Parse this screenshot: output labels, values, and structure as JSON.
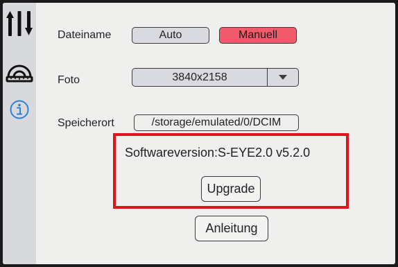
{
  "sidebar": {
    "items": [
      {
        "icon": "sliders-icon"
      },
      {
        "icon": "protractor-icon"
      },
      {
        "icon": "info-icon"
      }
    ]
  },
  "settings": {
    "filename": {
      "label": "Dateiname",
      "options": [
        "Auto",
        "Manuell"
      ],
      "selected": "Manuell"
    },
    "photo": {
      "label": "Foto",
      "value": "3840x2158"
    },
    "storage": {
      "label": "Speicherort",
      "path": "/storage/emulated/0/DCIM"
    }
  },
  "software": {
    "version_text": "Softwareversion:S-EYE2.0 v5.2.0",
    "upgrade_label": "Upgrade"
  },
  "manual_label": "Anleitung",
  "colors": {
    "active_button": "#f15a6b",
    "highlight_box": "#e3131b",
    "sidebar_accent": "#2f7fd6"
  }
}
